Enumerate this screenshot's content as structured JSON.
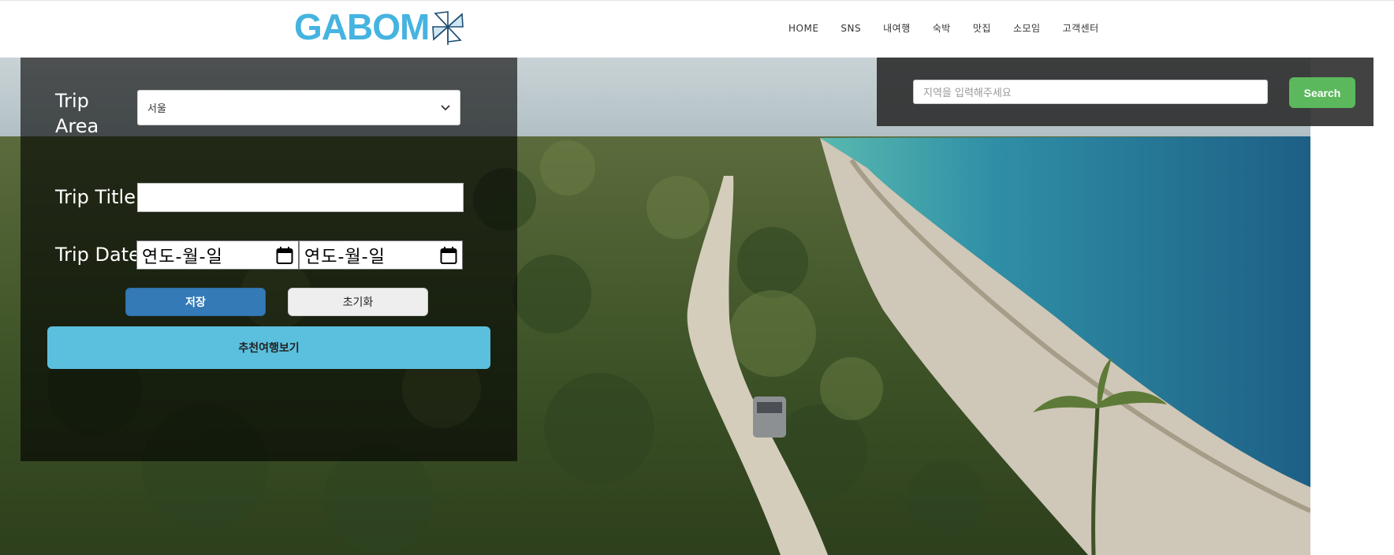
{
  "header": {
    "logo_text": "GABOM",
    "logo_icon": "pinwheel-icon",
    "nav": [
      "HOME",
      "SNS",
      "내여행",
      "숙박",
      "맛집",
      "소모임",
      "고객센터"
    ]
  },
  "form": {
    "area_label_line1": "Trip",
    "area_label_line2": "Area",
    "area_selected": "서울",
    "title_label": "Trip Title",
    "title_value": "",
    "date_label": "Trip Date",
    "start_date_placeholder": "연도-월-일",
    "end_date_placeholder": "연도-월-일",
    "save_label": "저장",
    "reset_label": "초기화",
    "recommend_label": "추천여행보기"
  },
  "search": {
    "placeholder": "지역을 입력해주세요",
    "button_label": "Search"
  },
  "colors": {
    "brand": "#45b4e0",
    "save": "#337ab7",
    "recommend": "#5bc0de",
    "search": "#5cb85c"
  }
}
